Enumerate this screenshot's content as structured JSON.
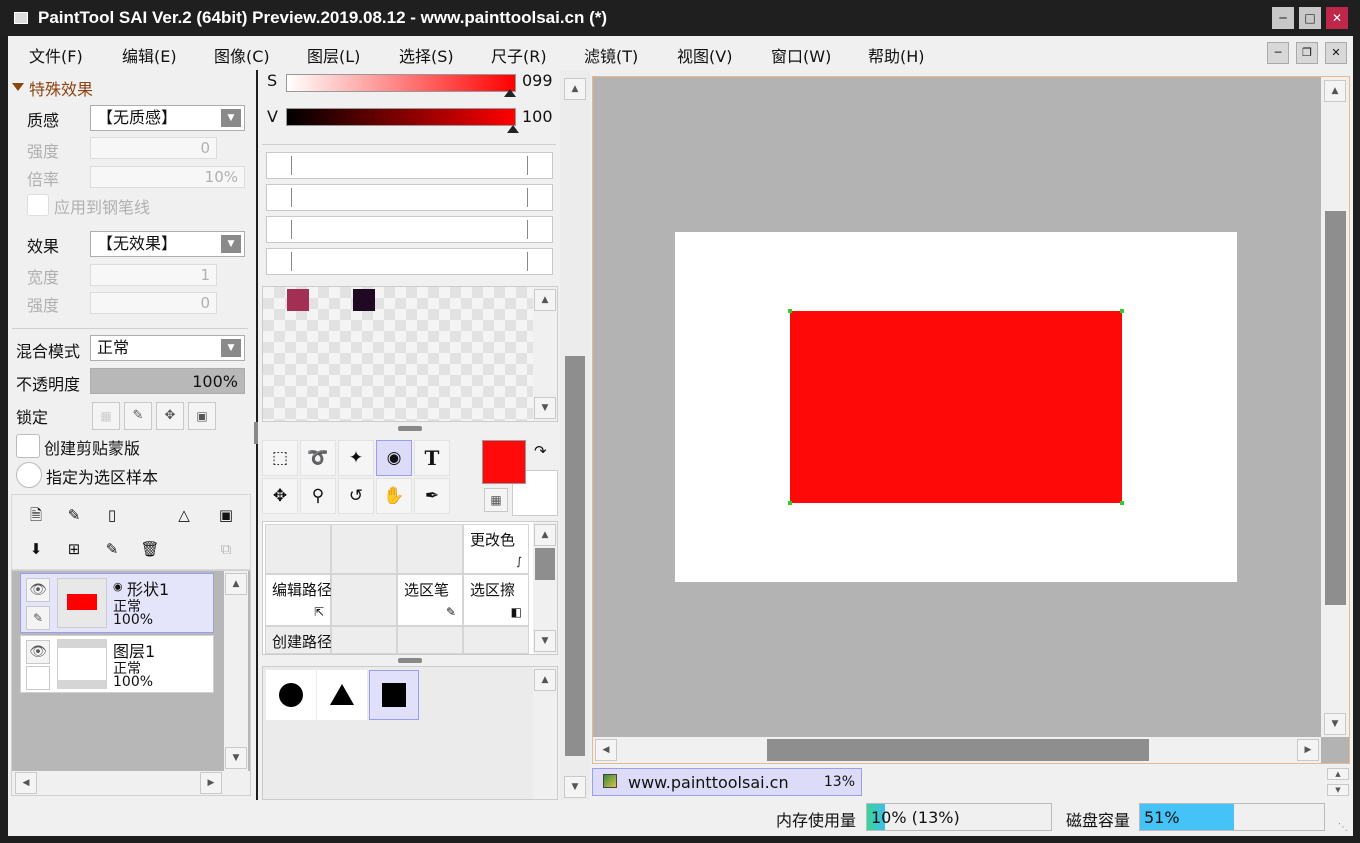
{
  "window": {
    "title": "PaintTool SAI Ver.2 (64bit) Preview.2019.08.12 - www.painttoolsai.cn (*)"
  },
  "menu": [
    "文件(F)",
    "编辑(E)",
    "图像(C)",
    "图层(L)",
    "选择(S)",
    "尺子(R)",
    "滤镜(T)",
    "视图(V)",
    "窗口(W)",
    "帮助(H)"
  ],
  "effects": {
    "header": "特殊效果",
    "texture_label": "质感",
    "texture_value": "【无质感】",
    "strength_label": "强度",
    "strength_value": "0",
    "scale_label": "倍率",
    "scale_value": "10%",
    "apply_pen_label": "应用到钢笔线",
    "effect_label": "效果",
    "effect_value": "【无效果】",
    "width_label": "宽度",
    "width_value": "1",
    "strength2_label": "强度",
    "strength2_value": "0"
  },
  "layer_props": {
    "blend_label": "混合模式",
    "blend_value": "正常",
    "opacity_label": "不透明度",
    "opacity_value": "100%",
    "opacity_fraction": 1.0,
    "lock_label": "锁定",
    "clipping_label": "创建剪贴蒙版",
    "sample_label": "指定为选区样本"
  },
  "layers": [
    {
      "name": "形状1",
      "mode": "正常",
      "opacity": "100%",
      "selected": true,
      "thumb_color": "#ff0000"
    },
    {
      "name": "图层1",
      "mode": "正常",
      "opacity": "100%",
      "selected": false,
      "thumb_color": "#ffffff"
    }
  ],
  "color": {
    "s_label": "S",
    "s_value": "099",
    "v_label": "V",
    "v_value": "100",
    "foreground": "#ff0a0a",
    "background": "#ffffff",
    "swatches": [
      "#a32f55",
      "#1f0a22"
    ]
  },
  "tools": {
    "text_tool_glyph": "T",
    "cells": [
      "更改色",
      "编辑路径",
      "选区笔",
      "选区擦",
      "创建路径"
    ]
  },
  "shapes": [
    "circle",
    "triangle",
    "square"
  ],
  "canvas": {
    "doc_name": "www.painttoolsai.cn",
    "zoom": "13%",
    "bg": "#b3b3b3",
    "paper": "#ffffff",
    "shape_color": "#ff0808"
  },
  "status": {
    "memory_label": "内存使用量",
    "memory_value": "10% (13%)",
    "memory_fraction": 0.1,
    "disk_label": "磁盘容量",
    "disk_value": "51%",
    "disk_fraction": 0.51
  }
}
